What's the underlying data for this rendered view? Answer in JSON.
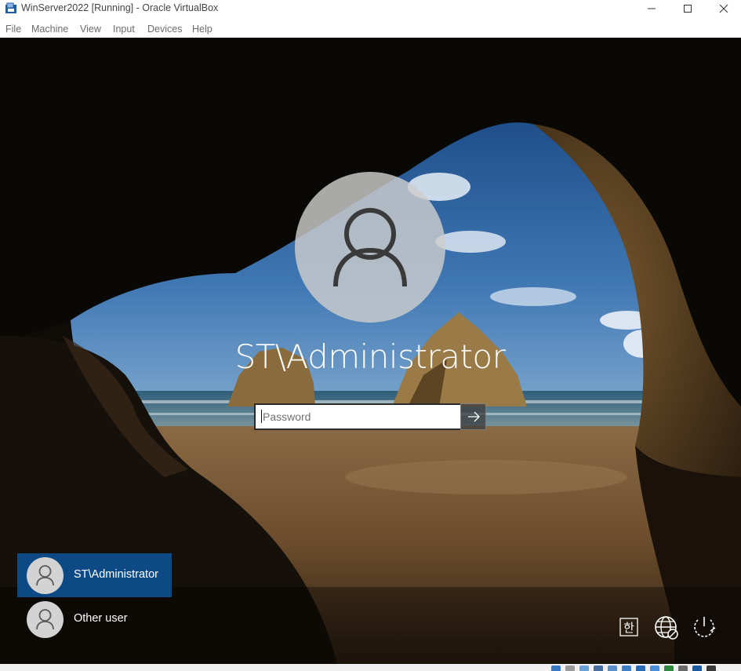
{
  "window": {
    "title": "WinServer2022 [Running] - Oracle VirtualBox",
    "app_icon": "virtualbox-icon",
    "controls": [
      "minimize-icon",
      "maximize-icon",
      "close-icon"
    ]
  },
  "menubar": {
    "items": [
      "File",
      "Machine",
      "View",
      "Input",
      "Devices",
      "Help"
    ]
  },
  "login": {
    "username": "ST\\Administrator",
    "password_placeholder": "Password",
    "submit_icon": "arrow-right-icon"
  },
  "user_list": [
    {
      "label": "ST\\Administrator",
      "selected": true
    },
    {
      "label": "Other user",
      "selected": false
    }
  ],
  "corner_buttons": {
    "ime_label": "한",
    "network_icon": "network-globe-icon",
    "power_icon": "power-icon"
  },
  "colors": {
    "selected_tile": "#0d4a85",
    "avatar_circle": "#cdcdcd"
  }
}
